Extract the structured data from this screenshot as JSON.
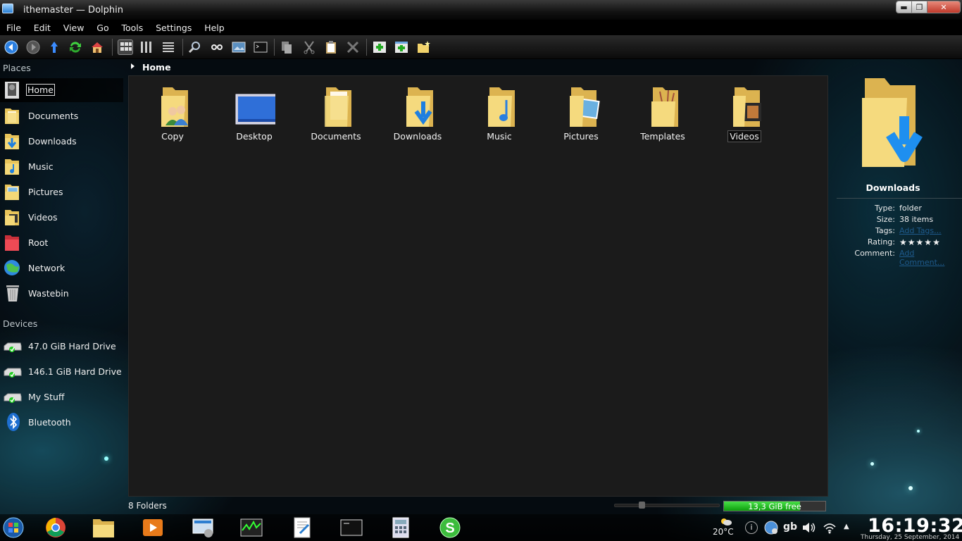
{
  "window": {
    "title": "ithemaster — Dolphin"
  },
  "menubar": [
    "File",
    "Edit",
    "View",
    "Go",
    "Tools",
    "Settings",
    "Help"
  ],
  "toolbar": {
    "buttons": [
      {
        "name": "back",
        "icon": "back-arrow-icon"
      },
      {
        "name": "forward",
        "icon": "forward-arrow-icon"
      },
      {
        "name": "up",
        "icon": "up-arrow-icon"
      },
      {
        "name": "reload",
        "icon": "reload-icon"
      },
      {
        "name": "home",
        "icon": "home-icon"
      },
      {
        "name": "icons-view",
        "icon": "icons-view-icon"
      },
      {
        "name": "compact-view",
        "icon": "compact-view-icon"
      },
      {
        "name": "details-view",
        "icon": "details-view-icon"
      },
      {
        "name": "find",
        "icon": "search-icon"
      },
      {
        "name": "preview",
        "icon": "preview-icon"
      },
      {
        "name": "split",
        "icon": "split-view-icon"
      },
      {
        "name": "terminal",
        "icon": "terminal-icon"
      },
      {
        "name": "copy",
        "icon": "copy-icon"
      },
      {
        "name": "cut",
        "icon": "scissors-icon"
      },
      {
        "name": "paste",
        "icon": "clipboard-icon"
      },
      {
        "name": "delete",
        "icon": "delete-icon"
      },
      {
        "name": "new-tab",
        "icon": "new-tab-icon"
      },
      {
        "name": "new-window",
        "icon": "new-window-icon"
      },
      {
        "name": "new-folder",
        "icon": "new-folder-icon"
      }
    ]
  },
  "places": {
    "header": "Places",
    "items": [
      {
        "label": "Home",
        "icon": "home-folder-icon",
        "selected": true
      },
      {
        "label": "Documents",
        "icon": "folder-documents-icon"
      },
      {
        "label": "Downloads",
        "icon": "folder-downloads-icon"
      },
      {
        "label": "Music",
        "icon": "folder-music-icon"
      },
      {
        "label": "Pictures",
        "icon": "folder-pictures-icon"
      },
      {
        "label": "Videos",
        "icon": "folder-videos-icon"
      },
      {
        "label": "Root",
        "icon": "folder-root-icon"
      },
      {
        "label": "Network",
        "icon": "network-globe-icon"
      },
      {
        "label": "Wastebin",
        "icon": "wastebin-icon"
      }
    ]
  },
  "devices": {
    "header": "Devices",
    "items": [
      {
        "label": "47.0 GiB Hard Drive",
        "icon": "hard-drive-icon"
      },
      {
        "label": "146.1 GiB Hard Drive",
        "icon": "hard-drive-icon"
      },
      {
        "label": "My Stuff",
        "icon": "hard-drive-icon"
      },
      {
        "label": "Bluetooth",
        "icon": "bluetooth-icon"
      }
    ]
  },
  "breadcrumb": {
    "current": "Home"
  },
  "files": [
    {
      "label": "Copy",
      "icon": "folder-users-icon"
    },
    {
      "label": "Desktop",
      "icon": "desktop-icon"
    },
    {
      "label": "Documents",
      "icon": "folder-documents-icon"
    },
    {
      "label": "Downloads",
      "icon": "folder-downloads-icon"
    },
    {
      "label": "Music",
      "icon": "folder-music-icon"
    },
    {
      "label": "Pictures",
      "icon": "folder-pictures-icon"
    },
    {
      "label": "Templates",
      "icon": "folder-templates-icon"
    },
    {
      "label": "Videos",
      "icon": "folder-videos-icon",
      "hover": true
    }
  ],
  "info": {
    "name": "Downloads",
    "rows": [
      {
        "key": "Type:",
        "value": "folder"
      },
      {
        "key": "Size:",
        "value": "38 items"
      },
      {
        "key": "Tags:",
        "value": "Add Tags...",
        "link": true
      },
      {
        "key": "Rating:",
        "rating": 5
      },
      {
        "key": "Comment:",
        "value": "Add Comment...",
        "link": true
      }
    ]
  },
  "status": {
    "count": "8 Folders",
    "free": "13,3 GiB free",
    "used_fraction": 0.75
  },
  "taskbar": {
    "apps": [
      "start-orb-icon",
      "chrome-icon",
      "file-manager-icon",
      "media-player-icon",
      "system-settings-icon",
      "system-monitor-icon",
      "text-editor-icon",
      "terminal-icon",
      "calculator-icon",
      "skype-icon"
    ],
    "weather": "20°C",
    "keyboard": "gb",
    "time": "16:19:32",
    "date": "Thursday, 25 September, 2014"
  },
  "colors": {
    "accent": "#1e90ff",
    "free_bar": "#22c322",
    "folder": "#f2d36b",
    "link": "#1e5a8c"
  }
}
